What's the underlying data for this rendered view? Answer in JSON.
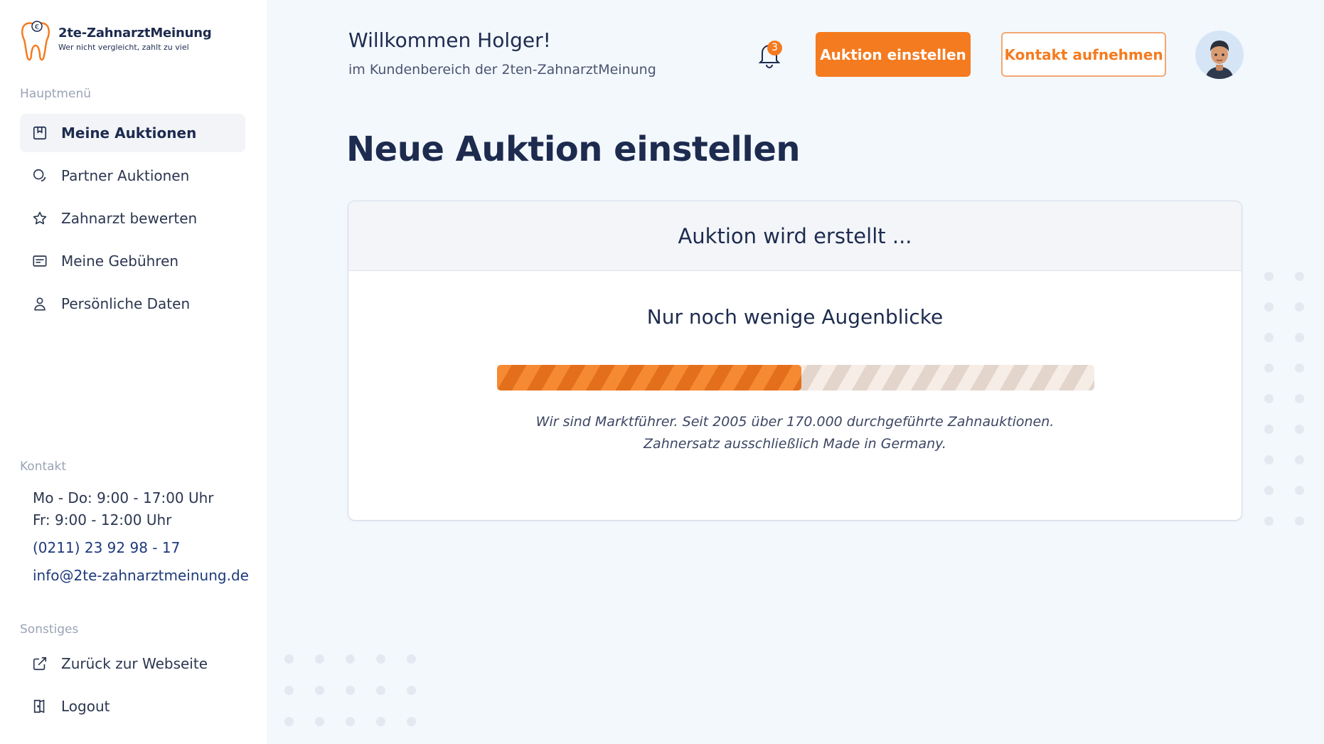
{
  "brand": {
    "name": "2te-ZahnarztMeinung",
    "tagline": "Wer nicht vergleicht, zahlt zu viel"
  },
  "sidebar": {
    "main_label": "Hauptmenü",
    "items": [
      {
        "label": "Meine Auktionen",
        "icon": "auction-icon",
        "active": true
      },
      {
        "label": "Partner Auktionen",
        "icon": "partner-icon",
        "active": false
      },
      {
        "label": "Zahnarzt bewerten",
        "icon": "star-icon",
        "active": false
      },
      {
        "label": "Meine Gebühren",
        "icon": "fees-icon",
        "active": false
      },
      {
        "label": "Persönliche Daten",
        "icon": "user-icon",
        "active": false
      }
    ],
    "contact_label": "Kontakt",
    "contact": {
      "hours_weekdays": "Mo - Do: 9:00 - 17:00 Uhr",
      "hours_friday": "Fr: 9:00 - 12:00 Uhr",
      "phone": "(0211) 23 92 98 - 17",
      "email": "info@2te-zahnarztmeinung.de"
    },
    "other_label": "Sonstiges",
    "other_items": [
      {
        "label": "Zurück zur Webseite",
        "icon": "external-link-icon"
      },
      {
        "label": "Logout",
        "icon": "logout-icon"
      }
    ]
  },
  "header": {
    "welcome": "Willkommen Holger!",
    "subtitle": "im Kundenbereich der 2ten-ZahnarztMeinung",
    "notification_count": "3",
    "primary_button": "Auktion einstellen",
    "secondary_button": "Kontakt aufnehmen"
  },
  "main": {
    "title": "Neue Auktion einstellen",
    "card": {
      "header": "Auktion wird erstellt ...",
      "subtitle": "Nur noch wenige Augenblicke",
      "progress_fraction": 0.51,
      "note_line1": "Wir sind Marktführer. Seit 2005 über 170.000 durchgeführte Zahnauktionen.",
      "note_line2": "Zahnersatz ausschließlich Made in Germany."
    }
  },
  "colors": {
    "accent": "#f47b20",
    "navy": "#1d2b4f"
  }
}
